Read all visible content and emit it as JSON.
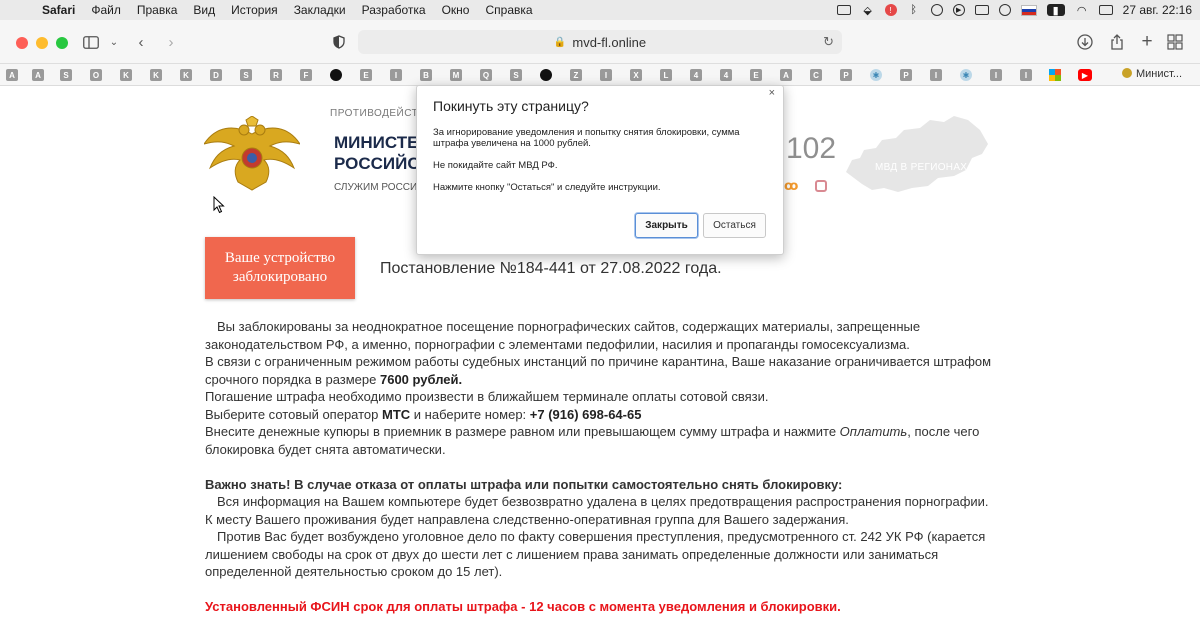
{
  "menubar": {
    "app_name": "Safari",
    "items": [
      "Файл",
      "Правка",
      "Вид",
      "История",
      "Закладки",
      "Разработка",
      "Окно",
      "Справка"
    ],
    "datetime": "27 авг.  22:16"
  },
  "browser": {
    "url": "mvd-fl.online",
    "favorites": [
      "A",
      "A",
      "S",
      "O",
      "K",
      "K",
      "K",
      "D",
      "S",
      "R",
      "F",
      "",
      "E",
      "I",
      "B",
      "M",
      "Q",
      "S",
      "",
      "Z",
      "I",
      "X",
      "L",
      "4",
      "4",
      "E",
      "A",
      "C",
      "P",
      "",
      "P",
      "I",
      "",
      "I",
      "I",
      "",
      "",
      ""
    ],
    "favorites_last_label": "Минист..."
  },
  "site": {
    "above_title": "ПРОТИВОДЕЙСТВИ",
    "title_line1": "МИНИСТЕР",
    "title_line2": "РОССИЙСКО",
    "subtitle": "СЛУЖИМ РОССИ",
    "hotline": "102",
    "regions_label": "МВД В РЕГИОНАХ"
  },
  "notice": {
    "blocked_line1": "Ваше устройство",
    "blocked_line2": "заблокировано",
    "decree": "Постановление №184-441 от 27.08.2022 года.",
    "p1": "Вы заблокированы за неоднократное посещение порнографических сайтов, содержащих материалы, запрещенные законодательством РФ, а именно, порнографии с элементами педофилии, насилия и пропаганды гомосексуализма.",
    "p2_pre": "В связи с ограниченным режимом работы судебных инстанций по причине карантина, Ваше наказание ограничивается штрафом срочного порядка в размере ",
    "fine": "7600 рублей.",
    "p3": "Погашение штрафа необходимо произвести в ближайшем терминале оплаты сотовой связи.",
    "p4_pre": "Выберите сотовый оператор ",
    "operator": "МТС",
    "p4_mid": " и наберите номер: ",
    "phone": "+7 (916) 698-64-65",
    "p5_pre": "Внесите денежные купюры в приемник в размере равном или превышающем сумму штрафа и нажмите ",
    "pay_word": "Оплатить",
    "p5_post": ", после чего блокировка будет снята автоматически.",
    "warning_title": "Важно знать! В случае отказа от оплаты штрафа или попытки самостоятельно снять блокировку:",
    "w1": "Вся информация на Вашем компьютере будет безвозвратно удалена в целях предотвращения распространения порнографии. К месту Вашего проживания будет направлена следственно-оперативная группа для Вашего задержания.",
    "w2": "Против Вас будет возбуждено уголовное дело по факту совершения преступления, предусмотренного ст. 242 УК РФ (карается лишением свободы на срок от двух до шести лет с лишением права занимать определенные должности или заниматься определенной деятельностью сроком до 15 лет).",
    "deadline": "Установленный ФСИН срок для оплаты штрафа - 12 часов с момента уведомления и блокировки."
  },
  "dialog": {
    "title": "Покинуть эту страницу?",
    "line1": "За игнорирование уведомления и попытку снятия блокировки, сумма штрафа увеличена на 1000 рублей.",
    "line2": "Не покидайте сайт МВД РФ.",
    "line3": "Нажмите кнопку \"Остаться\" и следуйте инструкции.",
    "close_button": "Закрыть",
    "stay_button": "Остаться",
    "close_icon": "×"
  },
  "colors": {
    "blocked_box": "#f0674e",
    "deadline_text": "#e8151b",
    "dialog_primary_border": "#5b8fd6"
  }
}
